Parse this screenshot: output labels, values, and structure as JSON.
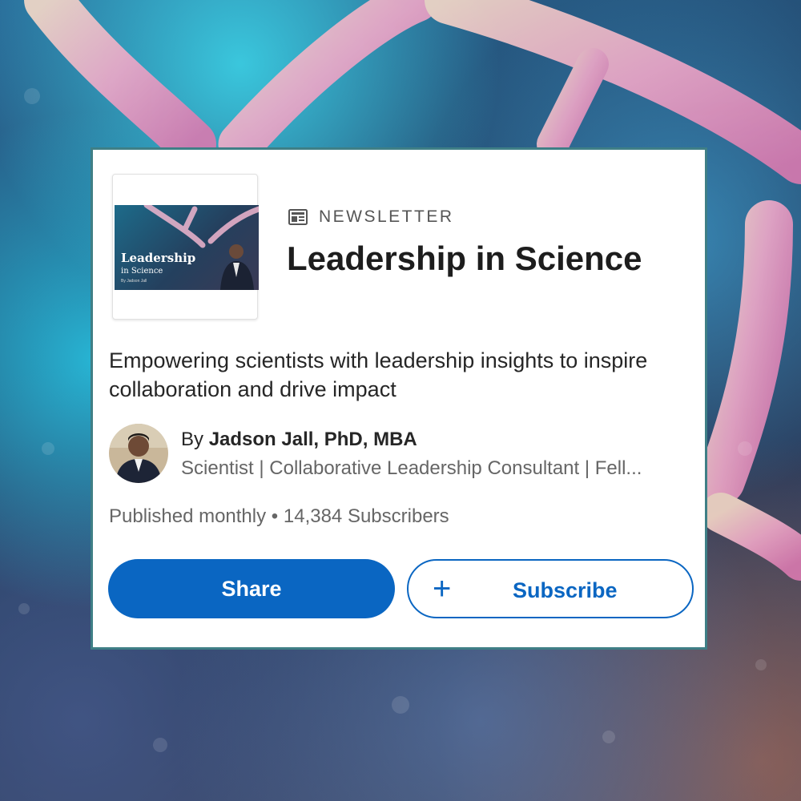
{
  "newsletter": {
    "type_label": "NEWSLETTER",
    "type_icon": "newspaper-icon",
    "title": "Leadership in Science",
    "description": "Empowering scientists with leadership insights to inspire collaboration and drive impact",
    "thumbnail": {
      "title": "Leadership",
      "subtitle": "in Science",
      "byline": "By Jadson Jall"
    }
  },
  "author": {
    "by_prefix": "By",
    "name": "Jadson Jall, PhD, MBA",
    "headline": "Scientist | Collaborative Leadership Consultant | Fell..."
  },
  "stats": {
    "frequency": "Published monthly",
    "separator": "•",
    "subscribers": "14,384 Subscribers"
  },
  "actions": {
    "share_label": "Share",
    "subscribe_label": "Subscribe",
    "subscribe_icon": "plus-icon"
  },
  "colors": {
    "accent": "#0a66c2",
    "card_border": "#3f7f86"
  }
}
